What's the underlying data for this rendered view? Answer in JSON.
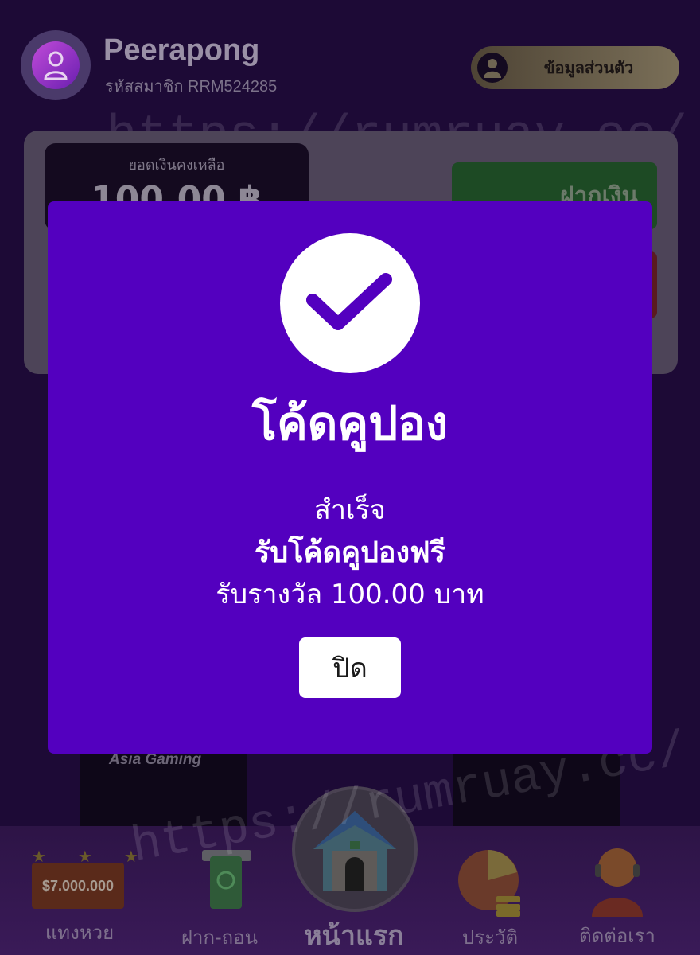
{
  "header": {
    "username": "Peerapong",
    "member_id": "รหัสสมาชิก RRM524285",
    "profile_button_label": "ข้อมูลส่วนตัว"
  },
  "watermark": {
    "text": "https://rumruay.cc/"
  },
  "wallet": {
    "balance_label": "ยอดเงินคงเหลือ",
    "balance_value": "100.00 ฿",
    "deposit_label": "ฝากเงิน"
  },
  "games": {
    "provider_label": "Asia Gaming"
  },
  "bottom_nav": {
    "lottery_board_text": "$7.000.000",
    "items": [
      {
        "label": "แทงหวย",
        "icon": "lottery-icon"
      },
      {
        "label": "ฝาก-ถอน",
        "icon": "atm-money-icon"
      },
      {
        "label": "หน้าแรก",
        "icon": "home-icon"
      },
      {
        "label": "ประวัติ",
        "icon": "pie-chart-coins-icon"
      },
      {
        "label": "ติดต่อเรา",
        "icon": "support-agent-icon"
      }
    ]
  },
  "modal": {
    "icon": "check-icon",
    "title": "โค้ดคูปอง",
    "line1": "สำเร็จ",
    "line2": "รับโค้ดคูปองฟรี",
    "line3": "รับรางวัล 100.00 บาท",
    "close_label": "ปิด"
  },
  "colors": {
    "modal_background": "#5300bf",
    "page_background": "#1d0a36",
    "check_color": "#5300bf"
  }
}
